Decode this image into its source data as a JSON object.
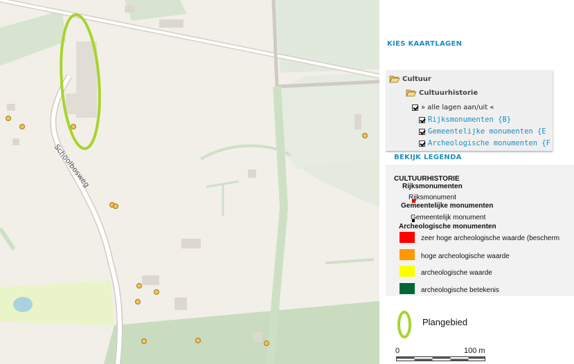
{
  "map": {
    "street_label": "Schoolbosweg",
    "colors": {
      "background": "#f2efe9",
      "green": "#c9dcc0",
      "road": "#e8e4dc",
      "building": "#d9d5cc",
      "highlight": "#a8d42a",
      "poi": "#f5c150"
    }
  },
  "panel": {
    "kies_kaartlagen": "KIES KAARTLAGEN",
    "tree": {
      "cultuur": "Cultuur",
      "cultuurhistorie": "Cultuurhistorie",
      "all_toggle": "» alle lagen aan/uit «",
      "layers": [
        {
          "label": "Rijksmonumenten {B}",
          "checked": true
        },
        {
          "label": "Gemeentelijke monumenten {E",
          "checked": true
        },
        {
          "label": "Archeologische monumenten {F",
          "checked": true
        }
      ]
    },
    "bekijk_legenda": "BEKIJK LEGENDA",
    "legend": {
      "title": "CULTUURHISTORIE",
      "rijks_header": "Rijksmonumenten",
      "rijks_item": "Rijksmonument",
      "gem_header": "Gemeentelijke monumenten",
      "gem_item": "Gemeentelijk monument",
      "arch_header": "Archeologische monumenten",
      "arch_items": [
        {
          "label": "zeer hoge archeologische waarde (bescherm",
          "color": "#ff0000"
        },
        {
          "label": "hoge archeologische waarde",
          "color": "#ff9900"
        },
        {
          "label": "archeologische waarde",
          "color": "#ffff00"
        },
        {
          "label": "archeologische betekenis",
          "color": "#006633"
        }
      ]
    },
    "plangebied": "Plangebied",
    "scale": {
      "start": "0",
      "end": "100 m"
    }
  }
}
